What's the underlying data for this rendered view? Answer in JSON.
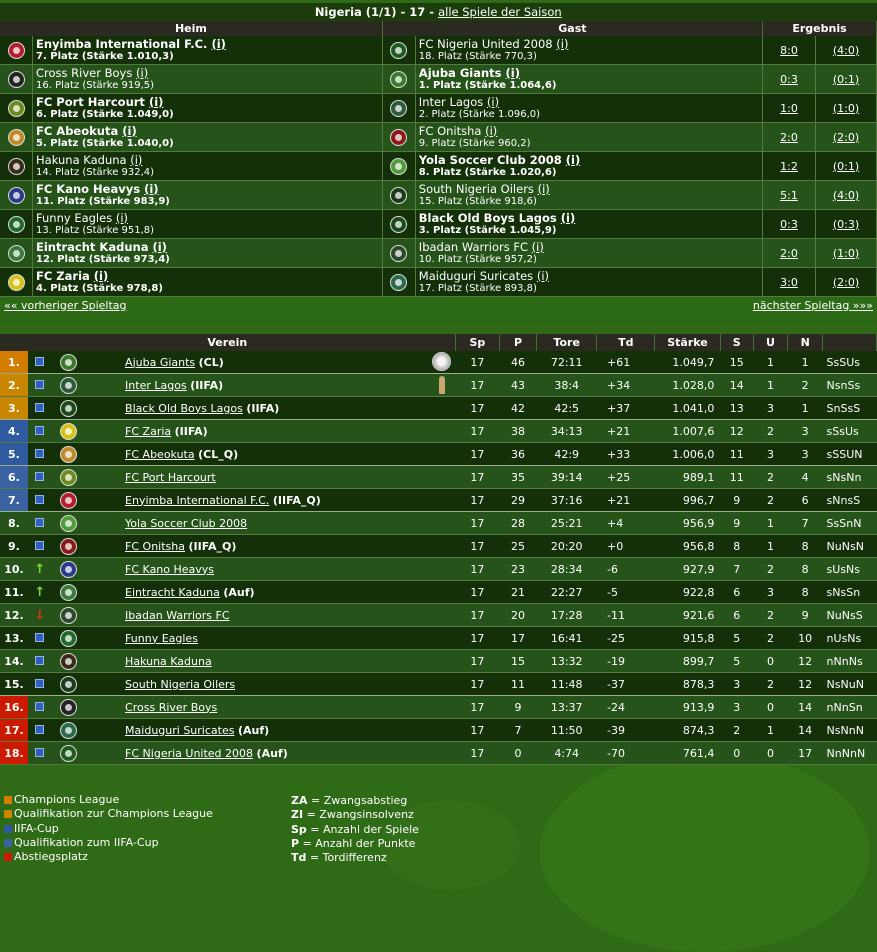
{
  "colors": {
    "champions": "#d47c00",
    "qual_champions": "#c98600",
    "iifa": "#2f5aa0",
    "qual_iifa": "#3a62a0",
    "relegation": "#cc1a00",
    "background": "#2f6b16"
  },
  "matchday": {
    "title": "Nigeria (1/1) - 17 -",
    "season_link": "alle Spiele der Saison",
    "headers": {
      "home": "Heim",
      "away": "Gast",
      "result": "Ergebnis"
    },
    "matches": [
      {
        "home": "Enyimba International F.C.",
        "home_sub": "7. Platz (Stärke 1.010,3)",
        "home_bold": true,
        "home_color": "#b41e2c",
        "away": "FC Nigeria United 2008",
        "away_sub": "18. Platz (Stärke 770,3)",
        "away_bold": false,
        "away_color": "#1f5a1f",
        "score": "8:0",
        "half": "(4:0)"
      },
      {
        "home": "Cross River Boys",
        "home_sub": "16. Platz (Stärke 919,5)",
        "home_bold": false,
        "home_color": "#222222",
        "away": "Ajuba Giants",
        "away_sub": "1. Platz (Stärke 1.064,6)",
        "away_bold": true,
        "away_color": "#3b7a2b",
        "score": "0:3",
        "half": "(0:1)"
      },
      {
        "home": "FC Port Harcourt",
        "home_sub": "6. Platz (Stärke 1.049,0)",
        "home_bold": true,
        "home_color": "#6c8b1e",
        "away": "Inter Lagos",
        "away_sub": "2. Platz (Stärke 1.096,0)",
        "away_bold": false,
        "away_color": "#2a5a3a",
        "score": "1:0",
        "half": "(1:0)"
      },
      {
        "home": "FC Abeokuta",
        "home_sub": "5. Platz (Stärke 1.040,0)",
        "home_bold": true,
        "home_color": "#c08a2a",
        "away": "FC Onitsha",
        "away_sub": "9. Platz (Stärke 960,2)",
        "away_bold": false,
        "away_color": "#8a1a1a",
        "score": "2:0",
        "half": "(2:0)"
      },
      {
        "home": "Hakuna Kaduna",
        "home_sub": "14. Platz (Stärke 932,4)",
        "home_bold": false,
        "home_color": "#3a2a1a",
        "away": "Yola Soccer Club 2008",
        "away_sub": "8. Platz (Stärke 1.020,6)",
        "away_bold": true,
        "away_color": "#4f9a3a",
        "score": "1:2",
        "half": "(0:1)"
      },
      {
        "home": "FC Kano Heavys",
        "home_sub": "11. Platz (Stärke 983,9)",
        "home_bold": true,
        "home_color": "#2a3a8a",
        "away": "South Nigeria Oilers",
        "away_sub": "15. Platz (Stärke 918,6)",
        "away_bold": false,
        "away_color": "#1a3a1a",
        "score": "5:1",
        "half": "(4:0)"
      },
      {
        "home": "Funny Eagles",
        "home_sub": "13. Platz (Stärke 951,8)",
        "home_bold": false,
        "home_color": "#1f6a2a",
        "away": "Black Old Boys Lagos",
        "away_sub": "3. Platz (Stärke 1.045,9)",
        "away_bold": true,
        "away_color": "#1a4a1a",
        "score": "0:3",
        "half": "(0:3)"
      },
      {
        "home": "Eintracht Kaduna",
        "home_sub": "12. Platz (Stärke 973,4)",
        "home_bold": true,
        "home_color": "#3a7a3a",
        "away": "Ibadan Warriors FC",
        "away_sub": "10. Platz (Stärke 957,2)",
        "away_bold": false,
        "away_color": "#2a4a2a",
        "score": "2:0",
        "half": "(1:0)"
      },
      {
        "home": "FC Zaria",
        "home_sub": "4. Platz (Stärke 978,8)",
        "home_bold": true,
        "home_color": "#d8c21a",
        "away": "Maiduguri Suricates",
        "away_sub": "17. Platz (Stärke 893,8)",
        "away_bold": false,
        "away_color": "#2a6a4a",
        "score": "3:0",
        "half": "(2:0)"
      }
    ],
    "info_link": "(i)",
    "prev": "«« vorheriger Spieltag",
    "next": "nächster Spieltag »»»"
  },
  "standings": {
    "headers": {
      "club": "Verein",
      "sp": "Sp",
      "p": "P",
      "tore": "Tore",
      "td": "Td",
      "staerke": "Stärke",
      "s": "S",
      "u": "U",
      "n": "N"
    },
    "rows": [
      {
        "rank": "1.",
        "zone": "champions",
        "arrow": "none",
        "name": "Ajuba Giants",
        "extra": "(CL)",
        "sp": "17",
        "p": "46",
        "tore": "72:11",
        "td": "+61",
        "staerke": "1.049,7",
        "s": "15",
        "u": "1",
        "n": "1",
        "form": "SsSUs",
        "logo": "#3b7a2b",
        "badge": "trophy"
      },
      {
        "rank": "2.",
        "zone": "qual_champions",
        "arrow": "none",
        "name": "Inter Lagos",
        "extra": "(IIFA)",
        "sp": "17",
        "p": "43",
        "tore": "38:4",
        "td": "+34",
        "staerke": "1.028,0",
        "s": "14",
        "u": "1",
        "n": "2",
        "form": "NsnSs",
        "logo": "#2a5a3a",
        "badge": "cup"
      },
      {
        "rank": "3.",
        "zone": "qual_champions",
        "arrow": "none",
        "name": "Black Old Boys Lagos",
        "extra": "(IIFA)",
        "sp": "17",
        "p": "42",
        "tore": "42:5",
        "td": "+37",
        "staerke": "1.041,0",
        "s": "13",
        "u": "3",
        "n": "1",
        "form": "SnSsS",
        "logo": "#1a4a1a",
        "badge": "none"
      },
      {
        "rank": "4.",
        "zone": "iifa",
        "arrow": "none",
        "name": "FC Zaria",
        "extra": "(IIFA)",
        "sp": "17",
        "p": "38",
        "tore": "34:13",
        "td": "+21",
        "staerke": "1.007,6",
        "s": "12",
        "u": "2",
        "n": "3",
        "form": "sSsUs",
        "logo": "#d8c21a",
        "badge": "none"
      },
      {
        "rank": "5.",
        "zone": "iifa",
        "arrow": "none",
        "name": "FC Abeokuta",
        "extra": "(CL_Q)",
        "sp": "17",
        "p": "36",
        "tore": "42:9",
        "td": "+33",
        "staerke": "1.006,0",
        "s": "11",
        "u": "3",
        "n": "3",
        "form": "sSSUN",
        "logo": "#c08a2a",
        "badge": "none"
      },
      {
        "rank": "6.",
        "zone": "qual_iifa",
        "arrow": "none",
        "name": "FC Port Harcourt",
        "extra": "",
        "sp": "17",
        "p": "35",
        "tore": "39:14",
        "td": "+25",
        "staerke": "989,1",
        "s": "11",
        "u": "2",
        "n": "4",
        "form": "sNsNn",
        "logo": "#6c8b1e",
        "badge": "none"
      },
      {
        "rank": "7.",
        "zone": "qual_iifa",
        "arrow": "none",
        "name": "Enyimba International F.C.",
        "extra": "(IIFA_Q)",
        "sp": "17",
        "p": "29",
        "tore": "37:16",
        "td": "+21",
        "staerke": "996,7",
        "s": "9",
        "u": "2",
        "n": "6",
        "form": "sNnsS",
        "logo": "#b41e2c",
        "badge": "none"
      },
      {
        "rank": "8.",
        "zone": "none",
        "arrow": "none",
        "name": "Yola Soccer Club 2008",
        "extra": "",
        "sp": "17",
        "p": "28",
        "tore": "25:21",
        "td": "+4",
        "staerke": "956,9",
        "s": "9",
        "u": "1",
        "n": "7",
        "form": "SsSnN",
        "logo": "#4f9a3a",
        "badge": "none"
      },
      {
        "rank": "9.",
        "zone": "none",
        "arrow": "none",
        "name": "FC Onitsha",
        "extra": "(IIFA_Q)",
        "sp": "17",
        "p": "25",
        "tore": "20:20",
        "td": "+0",
        "staerke": "956,8",
        "s": "8",
        "u": "1",
        "n": "8",
        "form": "NuNsN",
        "logo": "#8a1a1a",
        "badge": "none"
      },
      {
        "rank": "10.",
        "zone": "none",
        "arrow": "up",
        "name": "FC Kano Heavys",
        "extra": "",
        "sp": "17",
        "p": "23",
        "tore": "28:34",
        "td": "-6",
        "staerke": "927,9",
        "s": "7",
        "u": "2",
        "n": "8",
        "form": "sUsNs",
        "logo": "#2a3a8a",
        "badge": "none"
      },
      {
        "rank": "11.",
        "zone": "none",
        "arrow": "up",
        "name": "Eintracht Kaduna",
        "extra": "(Auf)",
        "sp": "17",
        "p": "21",
        "tore": "22:27",
        "td": "-5",
        "staerke": "922,8",
        "s": "6",
        "u": "3",
        "n": "8",
        "form": "sNsSn",
        "logo": "#3a7a3a",
        "badge": "none"
      },
      {
        "rank": "12.",
        "zone": "none",
        "arrow": "down",
        "name": "Ibadan Warriors FC",
        "extra": "",
        "sp": "17",
        "p": "20",
        "tore": "17:28",
        "td": "-11",
        "staerke": "921,6",
        "s": "6",
        "u": "2",
        "n": "9",
        "form": "NuNsS",
        "logo": "#2a4a2a",
        "badge": "none"
      },
      {
        "rank": "13.",
        "zone": "none",
        "arrow": "none",
        "name": "Funny Eagles",
        "extra": "",
        "sp": "17",
        "p": "17",
        "tore": "16:41",
        "td": "-25",
        "staerke": "915,8",
        "s": "5",
        "u": "2",
        "n": "10",
        "form": "nUsNs",
        "logo": "#1f6a2a",
        "badge": "none"
      },
      {
        "rank": "14.",
        "zone": "none",
        "arrow": "none",
        "name": "Hakuna Kaduna",
        "extra": "",
        "sp": "17",
        "p": "15",
        "tore": "13:32",
        "td": "-19",
        "staerke": "899,7",
        "s": "5",
        "u": "0",
        "n": "12",
        "form": "nNnNs",
        "logo": "#3a2a1a",
        "badge": "none"
      },
      {
        "rank": "15.",
        "zone": "none",
        "arrow": "none",
        "name": "South Nigeria Oilers",
        "extra": "",
        "sp": "17",
        "p": "11",
        "tore": "11:48",
        "td": "-37",
        "staerke": "878,3",
        "s": "3",
        "u": "2",
        "n": "12",
        "form": "NsNuN",
        "logo": "#1a3a1a",
        "badge": "none"
      },
      {
        "rank": "16.",
        "zone": "relegation",
        "arrow": "none",
        "name": "Cross River Boys",
        "extra": "",
        "sp": "17",
        "p": "9",
        "tore": "13:37",
        "td": "-24",
        "staerke": "913,9",
        "s": "3",
        "u": "0",
        "n": "14",
        "form": "nNnSn",
        "logo": "#222222",
        "badge": "none"
      },
      {
        "rank": "17.",
        "zone": "relegation",
        "arrow": "none",
        "name": "Maiduguri Suricates",
        "extra": "(Auf)",
        "sp": "17",
        "p": "7",
        "tore": "11:50",
        "td": "-39",
        "staerke": "874,3",
        "s": "2",
        "u": "1",
        "n": "14",
        "form": "NsNnN",
        "logo": "#2a6a4a",
        "badge": "none"
      },
      {
        "rank": "18.",
        "zone": "relegation",
        "arrow": "none",
        "name": "FC Nigeria United 2008",
        "extra": "(Auf)",
        "sp": "17",
        "p": "0",
        "tore": "4:74",
        "td": "-70",
        "staerke": "761,4",
        "s": "0",
        "u": "0",
        "n": "17",
        "form": "NnNnN",
        "logo": "#1f5a1f",
        "badge": "none"
      }
    ]
  },
  "legend": {
    "zones": [
      {
        "key": "champions",
        "label": "Champions League"
      },
      {
        "key": "qual_champions",
        "label": "Qualifikation zur Champions League"
      },
      {
        "key": "iifa",
        "label": "IIFA-Cup"
      },
      {
        "key": "qual_iifa",
        "label": "Qualifikation zum IIFA-Cup"
      },
      {
        "key": "relegation",
        "label": "Abstiegsplatz"
      }
    ],
    "abbreviations": [
      {
        "abbr": "ZA",
        "text": "= Zwangsabstieg"
      },
      {
        "abbr": "ZI",
        "text": "= Zwangsinsolvenz"
      },
      {
        "abbr": "Sp",
        "text": "= Anzahl der Spiele"
      },
      {
        "abbr": "P",
        "text": "= Anzahl der Punkte"
      },
      {
        "abbr": "Td",
        "text": "= Tordifferenz"
      }
    ]
  }
}
